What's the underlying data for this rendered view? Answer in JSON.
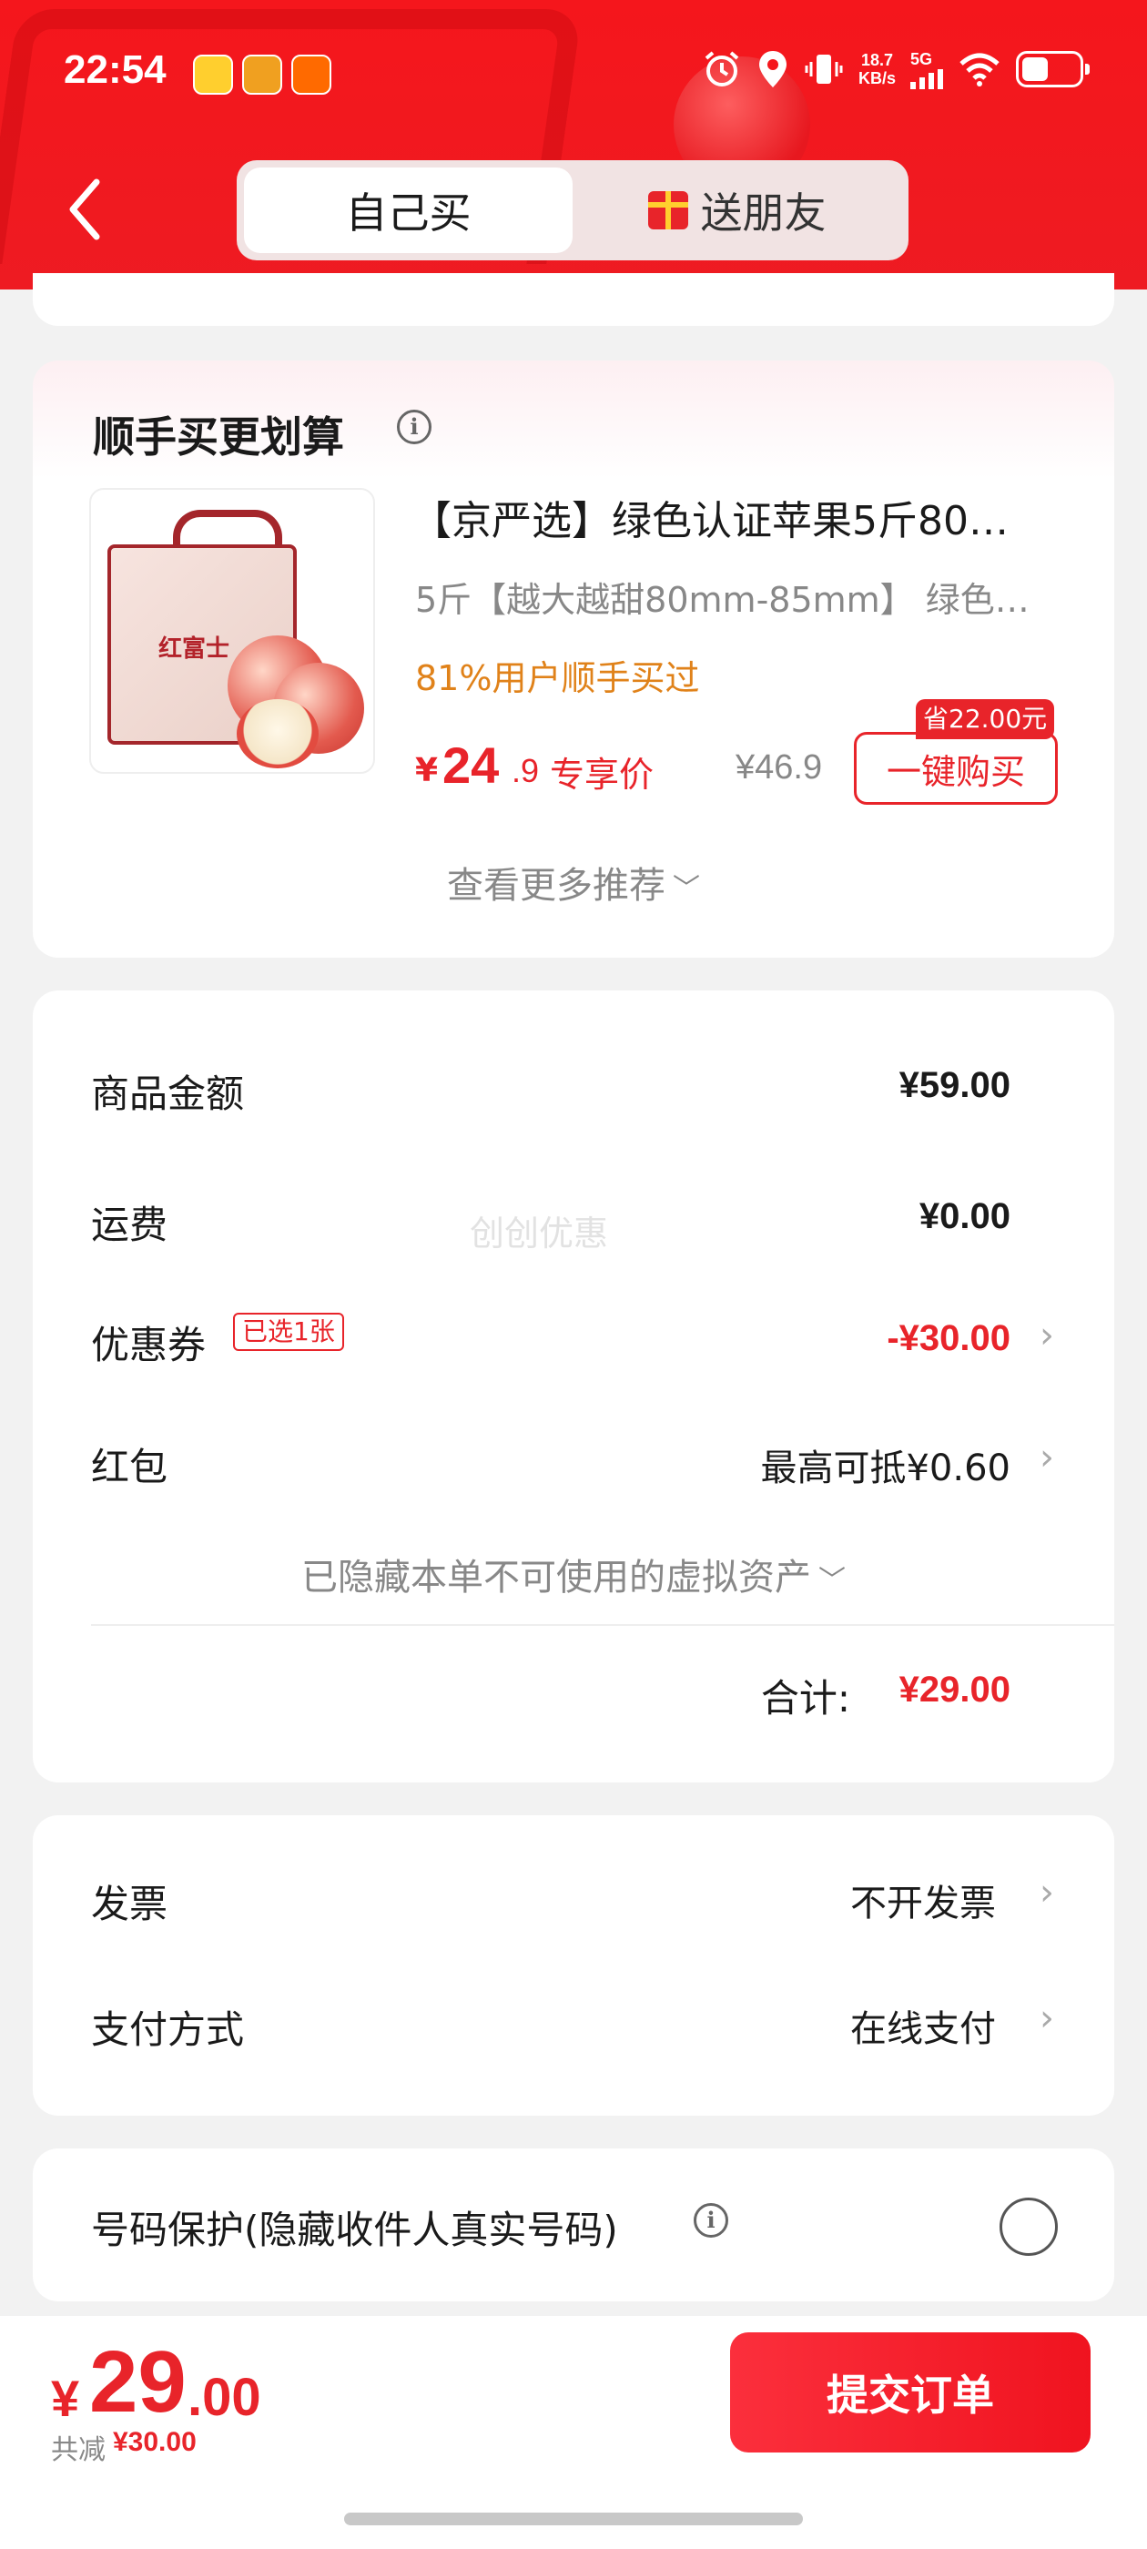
{
  "status_bar": {
    "time": "22:54",
    "net_speed_top": "18.7",
    "net_speed_bottom": "KB/s",
    "network": "5G"
  },
  "header": {
    "tab_self": "自己买",
    "tab_gift": "送朋友",
    "active_tab": "自己买",
    "theme_color": "#f5161c"
  },
  "recommend": {
    "title": "顺手买更划算",
    "product": {
      "image_label": "红富士",
      "title": "【京严选】绿色认证苹果5斤80…",
      "spec": "5斤【越大越甜80mm-85mm】 绿色…",
      "bought": "81%用户顺手买过",
      "price_currency": "¥",
      "price_int": "24",
      "price_dec": ".9",
      "price_tag": "专享价",
      "original_price": "¥46.9",
      "save_badge": "省22.00元",
      "buy_button": "一键购买"
    },
    "more": "查看更多推荐"
  },
  "amounts": {
    "goods_label": "商品金额",
    "goods_value": "¥59.00",
    "shipping_label": "运费",
    "shipping_value": "¥0.00",
    "watermark": "创创优惠",
    "coupon_label": "优惠券",
    "coupon_badge": "已选1张",
    "coupon_value": "-¥30.00",
    "redpacket_label": "红包",
    "redpacket_value": "最高可抵¥0.60",
    "hidden_assets": "已隐藏本单不可使用的虚拟资产",
    "total_label": "合计:",
    "total_value": "¥29.00"
  },
  "invoice": {
    "invoice_label": "发票",
    "invoice_value": "不开发票",
    "payment_label": "支付方式",
    "payment_value": "在线支付"
  },
  "privacy": {
    "label": "号码保护(隐藏收件人真实号码)",
    "checked": false
  },
  "bottom": {
    "currency": "¥",
    "amount_int": "29",
    "amount_dec": ".00",
    "saved_label": "共减",
    "saved_value": "¥30.00",
    "submit": "提交订单",
    "accent_color": "#e8242a"
  }
}
